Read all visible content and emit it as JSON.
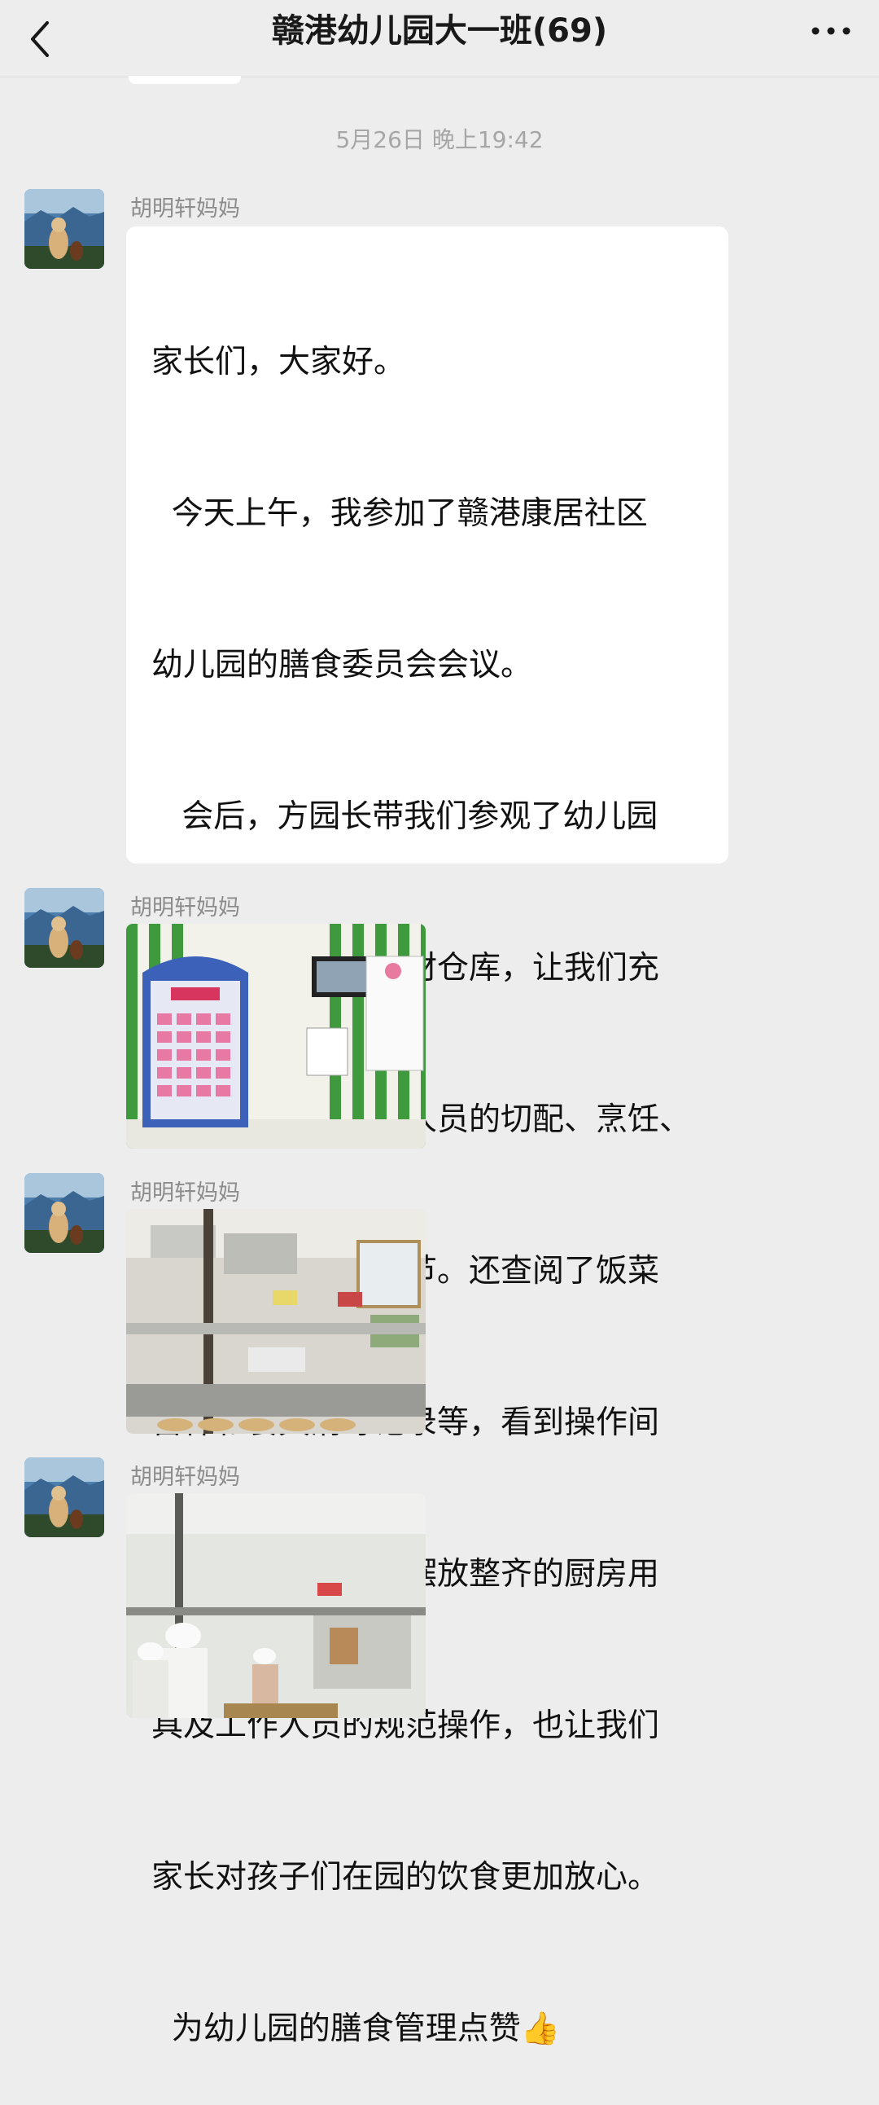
{
  "header": {
    "title": "赣港幼儿园大一班(69)",
    "back_icon": "chevron-left-icon",
    "more_icon": "more-dots-icon"
  },
  "chat": {
    "timestamp": "5月26日 晚上19:42",
    "messages": [
      {
        "sender": "胡明轩妈妈",
        "type": "text",
        "lines": [
          "家长们，大家好。",
          "  今天上午，我参加了赣港康居社区",
          "幼儿园的膳食委员会会议。",
          "   会后，方园长带我们参观了幼儿园",
          "厨房、操作间、食材仓库，让我们充",
          "分了解了厨房工作人员的切配、烹饪、",
          "食材安全等工作环节。还查阅了饭菜",
          "留样和餐具消毒记录等，看到操作间",
          "干净整洁的环境、摆放整齐的厨房用",
          "具及工作人员的规范操作，也让我们",
          "家长对孩子们在园的饮食更加放心。",
          "  为幼儿园的膳食管理点赞👍"
        ]
      },
      {
        "sender": "胡明轩妈妈",
        "type": "image",
        "image_name": "kitchen-menu-board-photo"
      },
      {
        "sender": "胡明轩妈妈",
        "type": "image",
        "image_name": "kitchen-counter-photo"
      },
      {
        "sender": "胡明轩妈妈",
        "type": "image",
        "image_name": "kitchen-staff-photo"
      }
    ]
  },
  "colors": {
    "background": "#ededed",
    "bubble": "#ffffff",
    "sender": "#8c8c8c",
    "timestamp": "#a6a6a6"
  }
}
